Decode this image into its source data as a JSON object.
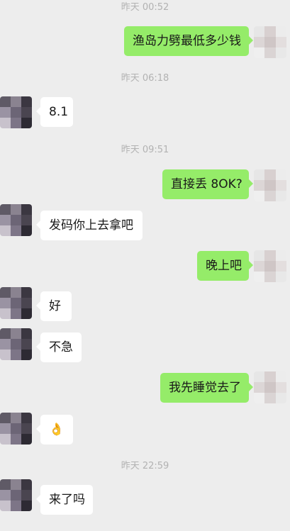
{
  "chat": {
    "timestamps": [
      "昨天 00:52",
      "昨天 06:18",
      "昨天 09:51",
      "昨天 22:59"
    ],
    "messages": [
      {
        "side": "out",
        "text": "渔岛力劈最低多少钱"
      },
      {
        "side": "in",
        "text": "8.1"
      },
      {
        "side": "out",
        "text": "直接丢 8OK?"
      },
      {
        "side": "in",
        "text": "发码你上去拿吧"
      },
      {
        "side": "out",
        "text": "晚上吧"
      },
      {
        "side": "in",
        "text": "好"
      },
      {
        "side": "in",
        "text": "不急"
      },
      {
        "side": "out",
        "text": "我先睡觉去了"
      },
      {
        "side": "in",
        "text": "👌"
      },
      {
        "side": "in",
        "text": "来了吗"
      }
    ]
  },
  "colors": {
    "background": "#ededed",
    "incoming_bubble": "#ffffff",
    "outgoing_bubble": "#95ec69",
    "timestamp_text": "#b2b2b2"
  },
  "icons": {
    "contact_avatar": "pixelated-avatar-icon",
    "self_avatar": "pixelated-avatar-icon"
  }
}
